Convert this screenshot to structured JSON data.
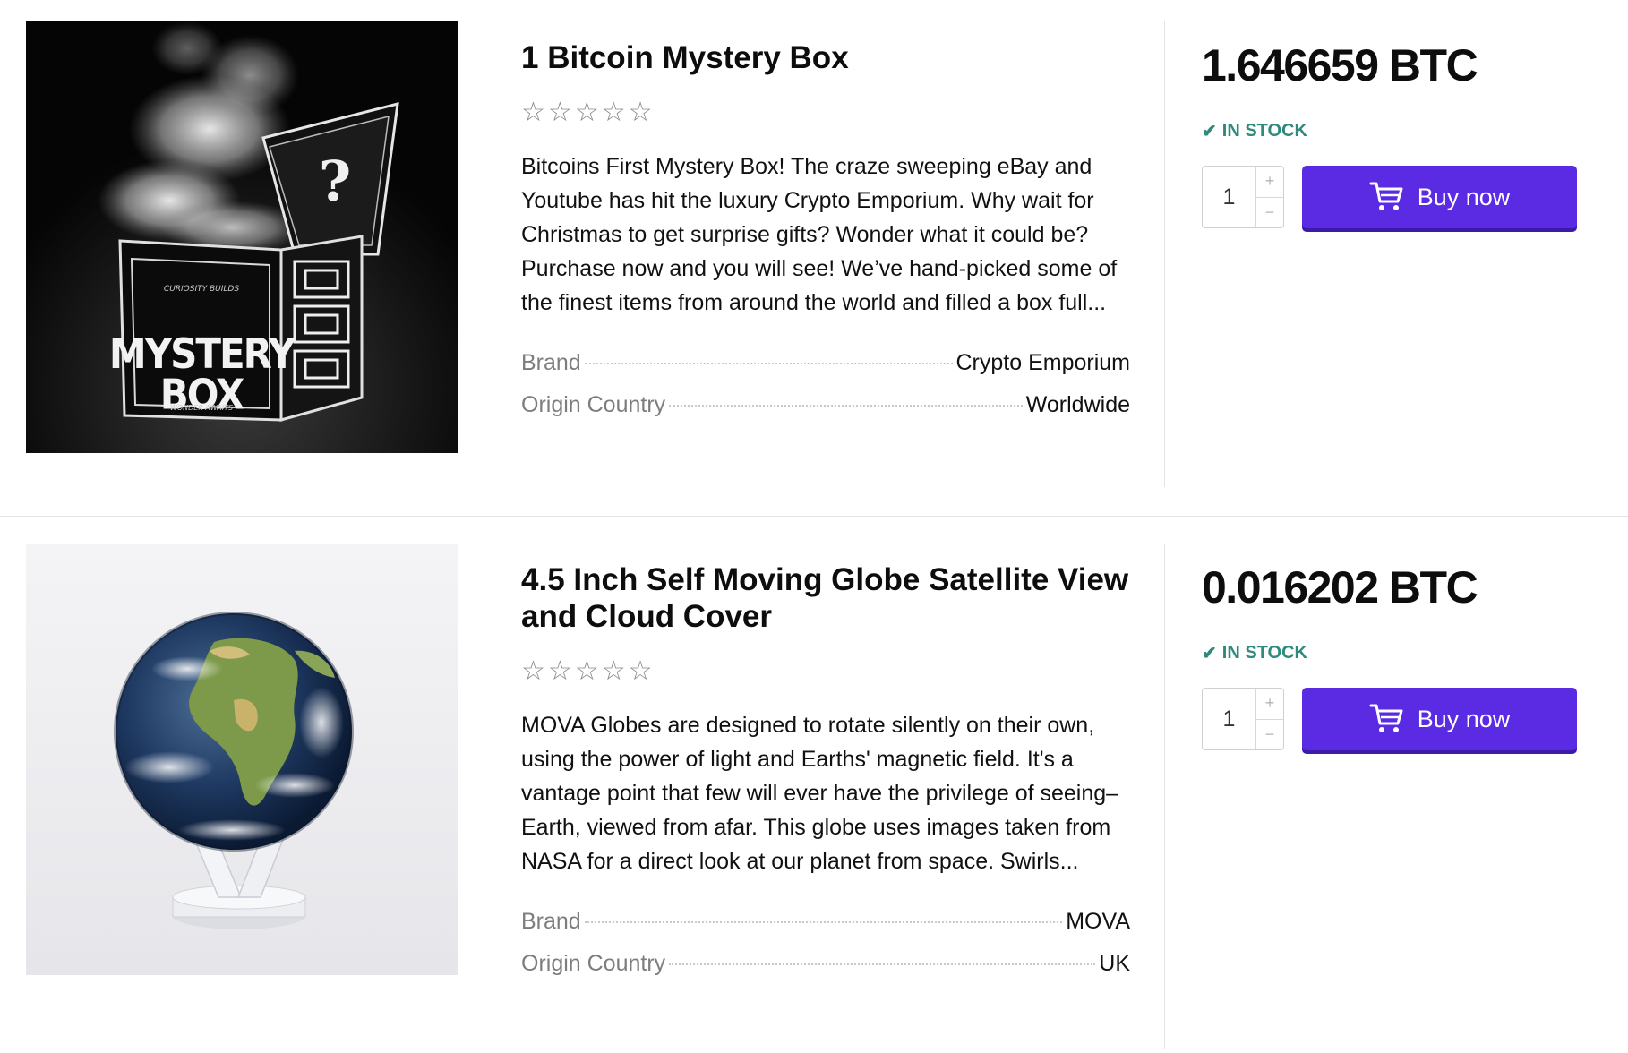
{
  "products": [
    {
      "title": "1 Bitcoin Mystery Box",
      "rating_stars": 0,
      "star_glyph": "☆",
      "description": "Bitcoins First Mystery Box! The craze sweeping eBay and Youtube has hit the luxury Crypto Emporium. Why wait for Christmas to get surprise gifts? Wonder what it could be? Purchase now and you will see! We’ve hand-picked some of the finest items from around the world and filled a box full...",
      "brand_label": "Brand",
      "brand_value": "Crypto Emporium",
      "origin_label": "Origin Country",
      "origin_value": "Worldwide",
      "price": "1.646659 BTC",
      "stock": "IN STOCK",
      "quantity": "1",
      "qty_plus": "+",
      "qty_minus": "−",
      "buy_label": "Buy now",
      "image": {
        "top_text": "CURIOSITY BUILDS",
        "main_line1": "MYSTERY",
        "main_line2": "BOX",
        "bottom_text": "WONDER AWAITS",
        "lid_symbol": "?"
      }
    },
    {
      "title": "4.5 Inch Self Moving Globe Satellite View and Cloud Cover",
      "rating_stars": 0,
      "star_glyph": "☆",
      "description": "MOVA Globes are designed to rotate silently on their own, using the power of light and Earths' magnetic field. It's a vantage point that few will ever have the privilege of seeing–Earth, viewed from afar. This globe uses images taken from NASA for a direct look at our planet from space. Swirls...",
      "brand_label": "Brand",
      "brand_value": "MOVA",
      "origin_label": "Origin Country",
      "origin_value": "UK",
      "price": "0.016202 BTC",
      "stock": "IN STOCK",
      "quantity": "1",
      "qty_plus": "+",
      "qty_minus": "−",
      "buy_label": "Buy now"
    }
  ],
  "colors": {
    "accent": "#5a2be2",
    "in_stock": "#2e8a7d",
    "star": "#8a8a8a"
  },
  "icons": {
    "cart": "cart-icon",
    "check": "check-icon",
    "star": "star-icon"
  }
}
